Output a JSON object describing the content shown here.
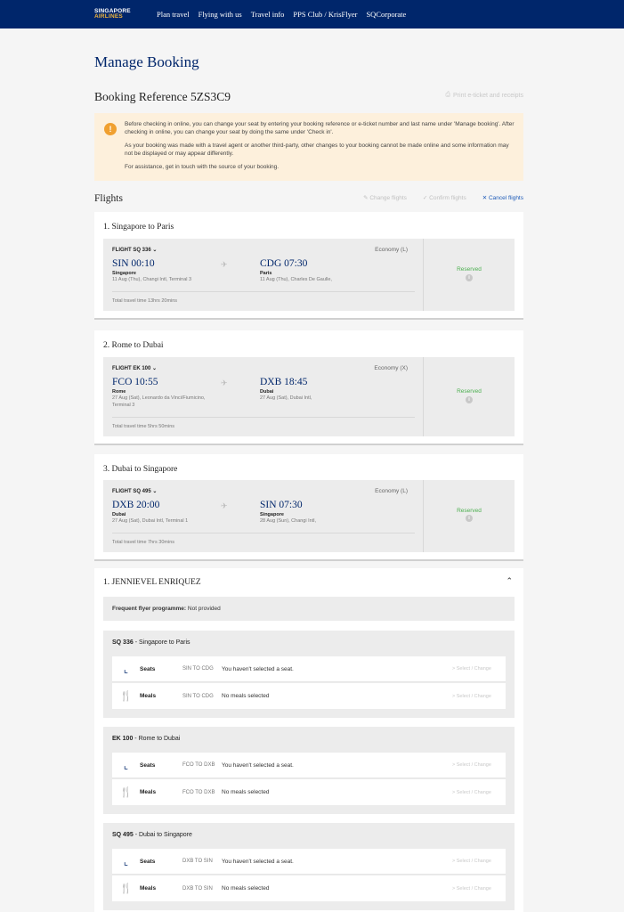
{
  "nav": {
    "logo_line1": "SINGAPORE",
    "logo_line2": "AIRLINES",
    "links": [
      "Plan travel",
      "Flying with us",
      "Travel info",
      "PPS Club / KrisFlyer",
      "SQCorporate"
    ]
  },
  "page_title": "Manage Booking",
  "booking_reference": "Booking Reference 5ZS3C9",
  "print_link": "Print e-ticket and receipts",
  "notice": {
    "p1": "Before checking in online, you can change your seat by entering your booking reference or e-ticket number and last name under 'Manage booking'. After checking in online, you can change your seat by doing the same under 'Check in'.",
    "p2": "As your booking was made with a travel agent or another third-party, other changes to your booking cannot be made online and some information may not be displayed or may appear differently.",
    "p3": "For assistance, get in touch with the source of your booking."
  },
  "flights_header": "Flights",
  "flight_actions": {
    "change": "Change flights",
    "confirm": "Confirm flights",
    "cancel": "Cancel flights"
  },
  "flights": [
    {
      "title": "1. Singapore to Paris",
      "flight_no": "FLIGHT SQ 336",
      "cabin": "Economy (L)",
      "dep_time": "SIN 00:10",
      "dep_city": "Singapore",
      "dep_detail": "11 Aug (Thu), Changi Intl, Terminal 3",
      "arr_time": "CDG 07:30",
      "arr_city": "Paris",
      "arr_detail": "11 Aug (Thu), Charles De Gaulle,",
      "total_time": "Total travel time 13hrs 20mins",
      "status": "Reserved"
    },
    {
      "title": "2. Rome to Dubai",
      "flight_no": "FLIGHT EK 100",
      "cabin": "Economy (X)",
      "dep_time": "FCO 10:55",
      "dep_city": "Rome",
      "dep_detail": "27 Aug (Sat), Leonardo da Vinci/Fiumicino, Terminal 3",
      "arr_time": "DXB 18:45",
      "arr_city": "Dubai",
      "arr_detail": "27 Aug (Sat), Dubai Intl,",
      "total_time": "Total travel time 5hrs 50mins",
      "status": "Reserved"
    },
    {
      "title": "3. Dubai to Singapore",
      "flight_no": "FLIGHT SQ 495",
      "cabin": "Economy (L)",
      "dep_time": "DXB 20:00",
      "dep_city": "Dubai",
      "dep_detail": "27 Aug (Sat), Dubai Intl, Terminal 1",
      "arr_time": "SIN 07:30",
      "arr_city": "Singapore",
      "arr_detail": "28 Aug (Sun), Changi Intl,",
      "total_time": "Total travel time 7hrs 30mins",
      "status": "Reserved"
    }
  ],
  "passenger": {
    "name": "1. JENNIEVEL ENRIQUEZ",
    "ff_label": "Frequent flyer programme:",
    "ff_value": "Not provided",
    "segments": [
      {
        "code": "SQ 336",
        "route": " - Singapore to Paris",
        "seat_route": "SIN TO CDG",
        "meal_route": "SIN TO CDG"
      },
      {
        "code": "EK 100",
        "route": " - Rome to Dubai",
        "seat_route": "FCO TO DXB",
        "meal_route": "FCO TO DXB"
      },
      {
        "code": "SQ 495",
        "route": " - Dubai to Singapore",
        "seat_route": "DXB TO SIN",
        "meal_route": "DXB TO SIN"
      }
    ],
    "seats_label": "Seats",
    "meals_label": "Meals",
    "seat_msg": "You haven't selected a seat.",
    "meal_msg": "No meals selected",
    "select_change": "Select / Change"
  }
}
